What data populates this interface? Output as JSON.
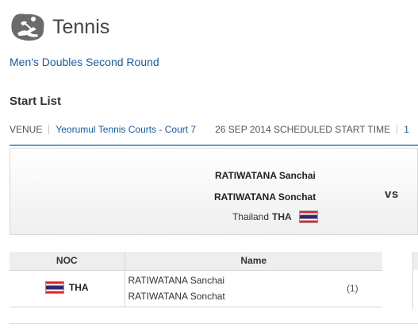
{
  "header": {
    "sport_icon": "tennis-pictogram-icon",
    "title": "Tennis"
  },
  "event": {
    "name": "Men's Doubles Second Round"
  },
  "section": {
    "title": "Start List"
  },
  "info": {
    "venue_label": "VENUE",
    "venue_name": "Yeorumul Tennis Courts - Court 7",
    "date_time": "26 SEP 2014 SCHEDULED START TIME",
    "more": "1"
  },
  "match": {
    "player1": "RATIWATANA Sanchai",
    "player2": "RATIWATANA Sonchat",
    "country_name": "Thailand",
    "country_code": "THA",
    "flag_icon": "thailand-flag-icon",
    "vs": "vs"
  },
  "table": {
    "headers": {
      "noc": "NOC",
      "name": "Name"
    },
    "rows": [
      {
        "noc": "THA",
        "flag_icon": "thailand-flag-icon",
        "names": [
          "RATIWATANA Sanchai",
          "RATIWATANA Sonchat"
        ],
        "seed": "(1)"
      }
    ]
  },
  "colors": {
    "link": "#1a5c9e",
    "divider": "#5b9fd8",
    "header_bg": "#eeeeee"
  }
}
